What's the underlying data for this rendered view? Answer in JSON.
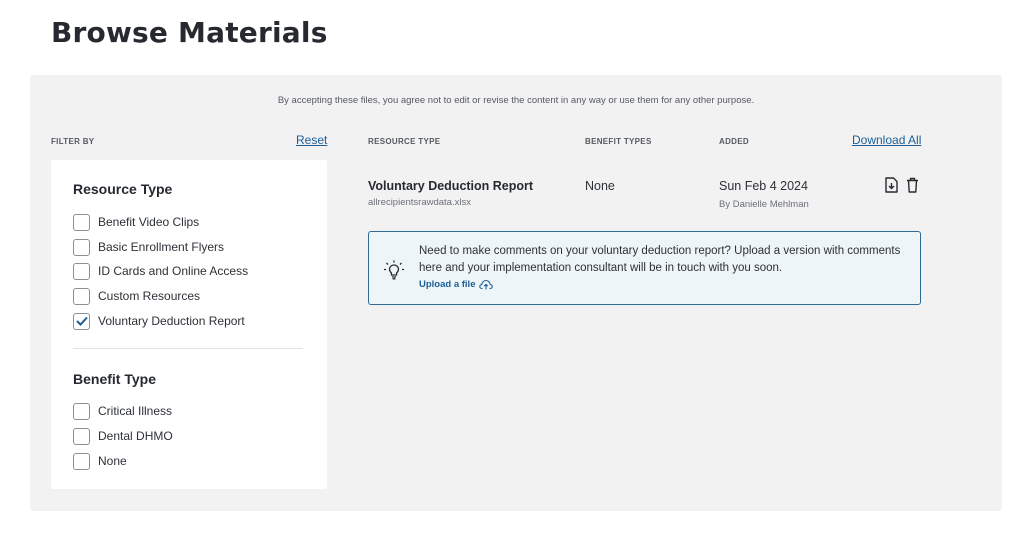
{
  "page": {
    "title": "Browse Materials"
  },
  "disclaimer": "By accepting these files, you agree not to edit or revise the content in any way or use them for any other purpose.",
  "filters": {
    "heading": "FILTER BY",
    "reset_label": "Reset",
    "groups": [
      {
        "title": "Resource Type",
        "options": [
          {
            "label": "Benefit Video Clips",
            "checked": false
          },
          {
            "label": "Basic Enrollment Flyers",
            "checked": false
          },
          {
            "label": "ID Cards and Online Access",
            "checked": false
          },
          {
            "label": "Custom Resources",
            "checked": false
          },
          {
            "label": "Voluntary Deduction Report",
            "checked": true
          }
        ]
      },
      {
        "title": "Benefit Type",
        "options": [
          {
            "label": "Critical Illness",
            "checked": false
          },
          {
            "label": "Dental DHMO",
            "checked": false
          },
          {
            "label": "None",
            "checked": false
          }
        ]
      }
    ]
  },
  "table": {
    "columns": {
      "resource_type": "RESOURCE TYPE",
      "benefit_types": "BENEFIT TYPES",
      "added": "ADDED"
    },
    "download_all_label": "Download All",
    "rows": [
      {
        "title": "Voluntary Deduction Report",
        "filename": "allrecipientsrawdata.xlsx",
        "benefit": "None",
        "date": "Sun Feb 4 2024",
        "added_by": "By Danielle Mehlman"
      }
    ]
  },
  "notice": {
    "text": "Need to make comments on your voluntary deduction report? Upload a version with comments here and your implementation consultant will be in touch with you soon.",
    "upload_label": "Upload a file"
  },
  "icons": {
    "download": "download-file-icon",
    "delete": "trash-icon",
    "notice": "lightbulb-icon",
    "upload": "cloud-upload-icon",
    "check": "checkmark-icon"
  },
  "colors": {
    "link": "#1b5e97",
    "panel": "#f2f2f3",
    "notice_border": "#2f6c95",
    "notice_bg": "#eef5f8"
  }
}
